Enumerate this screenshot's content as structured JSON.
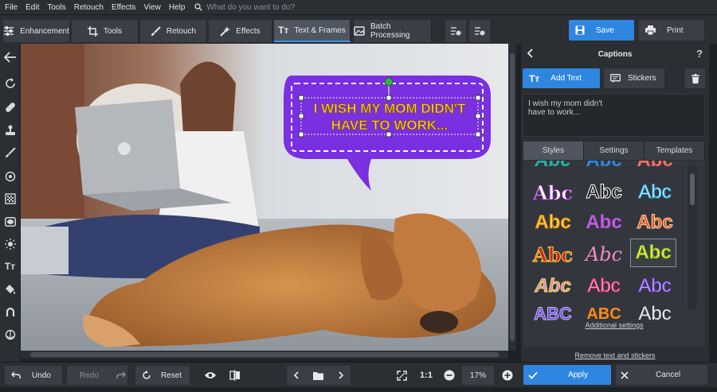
{
  "menu": {
    "items": [
      "File",
      "Edit",
      "Tools",
      "Retouch",
      "Effects",
      "View",
      "Help"
    ],
    "search_placeholder": "What do you want to do?"
  },
  "toolbar": {
    "tabs": [
      "Enhancement",
      "Tools",
      "Retouch",
      "Effects",
      "Text & Frames",
      "Batch Processing"
    ],
    "active_tab": "Text & Frames",
    "save_label": "Save",
    "print_label": "Print"
  },
  "left_tools": [
    "back-arrow-icon",
    "rotate-icon",
    "heal-icon",
    "stamp-icon",
    "brush-icon",
    "target-icon",
    "gradient-icon",
    "vignette-icon",
    "sun-icon",
    "text-icon",
    "fill-icon",
    "lasso-icon",
    "shape-icon"
  ],
  "canvas": {
    "caption_line1": "I WISH MY MOM DIDN'T",
    "caption_line2": "HAVE TO WORK..."
  },
  "panel": {
    "title": "Captions",
    "help": "?",
    "add_text": "Add Text",
    "stickers": "Stickers",
    "text_value": "I wish my mom didn't\nhave to work...",
    "tabs": [
      "Styles",
      "Settings",
      "Templates"
    ],
    "active_tab": "Styles",
    "styles": [
      "Abc",
      "Abc",
      "Abc",
      "Abc",
      "Abc",
      "Abc",
      "Abc",
      "Abc",
      "Abc",
      "Abc",
      "Abc",
      "Abc",
      "Abc",
      "Abc",
      "Abc",
      "ABC",
      "ABC",
      "Abc"
    ],
    "selected_style": 11,
    "additional_settings": "Additional settings",
    "remove_link": "Remove text and stickers"
  },
  "bottom": {
    "undo": "Undo",
    "redo": "Redo",
    "reset": "Reset",
    "ratio": "1:1",
    "zoom": "17%",
    "apply": "Apply",
    "cancel": "Cancel"
  },
  "colors": {
    "accent": "#2f86e0",
    "bubble": "#7a2fe0",
    "caption": "#f5d53a"
  }
}
